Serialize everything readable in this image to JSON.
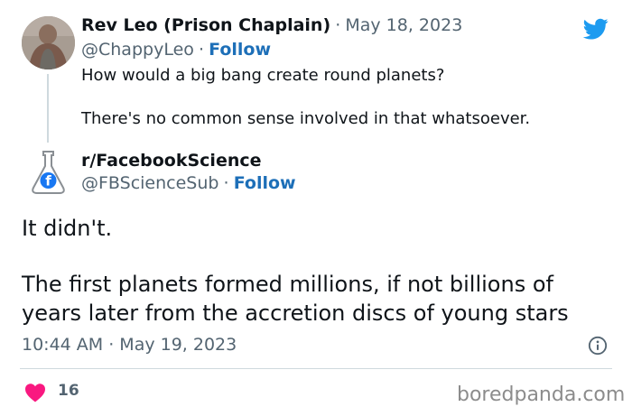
{
  "original_tweet": {
    "display_name": "Rev Leo (Prison Chaplain)",
    "separator": "·",
    "date": "May 18, 2023",
    "handle": "@ChappyLeo",
    "follow_label": "Follow",
    "paragraphs": [
      "How would a big bang create round planets?",
      "There's no common sense involved in that whatsoever."
    ]
  },
  "reply": {
    "display_name": "r/FacebookScience",
    "handle": "@FBScienceSub",
    "separator": "·",
    "follow_label": "Follow",
    "paragraphs": [
      "It didn't.",
      "The first planets formed millions, if not billions of years later from the accretion discs of young stars"
    ],
    "timestamp": "10:44 AM · May 19, 2023",
    "like_count": "16"
  },
  "watermark": "boredpanda.com",
  "colors": {
    "twitter_blue": "#1d9bf0",
    "follow_blue": "#1d6fb8",
    "heart_pink": "#f91880",
    "muted_gray": "#536471"
  },
  "icons": [
    "twitter-bird-icon",
    "info-icon",
    "heart-icon",
    "flask-facebook-icon"
  ]
}
